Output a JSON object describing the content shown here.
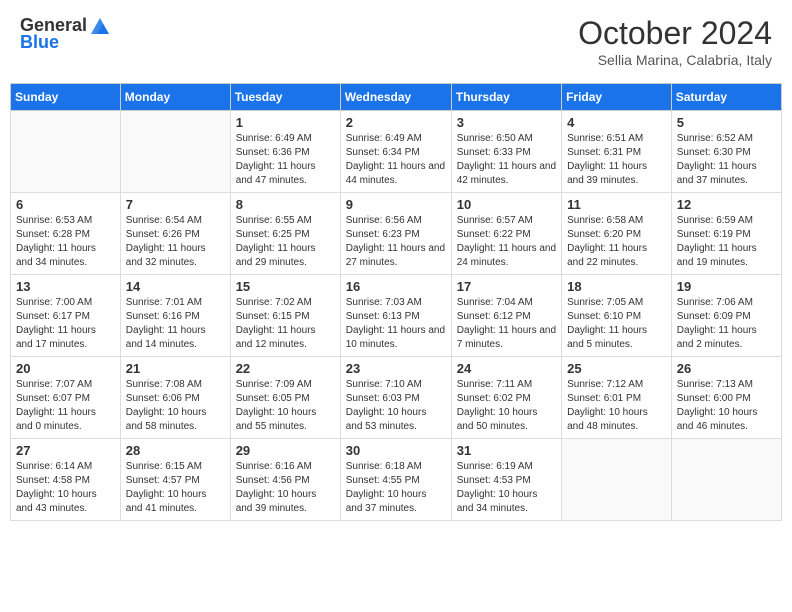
{
  "header": {
    "logo_general": "General",
    "logo_blue": "Blue",
    "month_title": "October 2024",
    "subtitle": "Sellia Marina, Calabria, Italy"
  },
  "weekdays": [
    "Sunday",
    "Monday",
    "Tuesday",
    "Wednesday",
    "Thursday",
    "Friday",
    "Saturday"
  ],
  "weeks": [
    [
      {
        "day": "",
        "info": ""
      },
      {
        "day": "",
        "info": ""
      },
      {
        "day": "1",
        "info": "Sunrise: 6:49 AM\nSunset: 6:36 PM\nDaylight: 11 hours and 47 minutes."
      },
      {
        "day": "2",
        "info": "Sunrise: 6:49 AM\nSunset: 6:34 PM\nDaylight: 11 hours and 44 minutes."
      },
      {
        "day": "3",
        "info": "Sunrise: 6:50 AM\nSunset: 6:33 PM\nDaylight: 11 hours and 42 minutes."
      },
      {
        "day": "4",
        "info": "Sunrise: 6:51 AM\nSunset: 6:31 PM\nDaylight: 11 hours and 39 minutes."
      },
      {
        "day": "5",
        "info": "Sunrise: 6:52 AM\nSunset: 6:30 PM\nDaylight: 11 hours and 37 minutes."
      }
    ],
    [
      {
        "day": "6",
        "info": "Sunrise: 6:53 AM\nSunset: 6:28 PM\nDaylight: 11 hours and 34 minutes."
      },
      {
        "day": "7",
        "info": "Sunrise: 6:54 AM\nSunset: 6:26 PM\nDaylight: 11 hours and 32 minutes."
      },
      {
        "day": "8",
        "info": "Sunrise: 6:55 AM\nSunset: 6:25 PM\nDaylight: 11 hours and 29 minutes."
      },
      {
        "day": "9",
        "info": "Sunrise: 6:56 AM\nSunset: 6:23 PM\nDaylight: 11 hours and 27 minutes."
      },
      {
        "day": "10",
        "info": "Sunrise: 6:57 AM\nSunset: 6:22 PM\nDaylight: 11 hours and 24 minutes."
      },
      {
        "day": "11",
        "info": "Sunrise: 6:58 AM\nSunset: 6:20 PM\nDaylight: 11 hours and 22 minutes."
      },
      {
        "day": "12",
        "info": "Sunrise: 6:59 AM\nSunset: 6:19 PM\nDaylight: 11 hours and 19 minutes."
      }
    ],
    [
      {
        "day": "13",
        "info": "Sunrise: 7:00 AM\nSunset: 6:17 PM\nDaylight: 11 hours and 17 minutes."
      },
      {
        "day": "14",
        "info": "Sunrise: 7:01 AM\nSunset: 6:16 PM\nDaylight: 11 hours and 14 minutes."
      },
      {
        "day": "15",
        "info": "Sunrise: 7:02 AM\nSunset: 6:15 PM\nDaylight: 11 hours and 12 minutes."
      },
      {
        "day": "16",
        "info": "Sunrise: 7:03 AM\nSunset: 6:13 PM\nDaylight: 11 hours and 10 minutes."
      },
      {
        "day": "17",
        "info": "Sunrise: 7:04 AM\nSunset: 6:12 PM\nDaylight: 11 hours and 7 minutes."
      },
      {
        "day": "18",
        "info": "Sunrise: 7:05 AM\nSunset: 6:10 PM\nDaylight: 11 hours and 5 minutes."
      },
      {
        "day": "19",
        "info": "Sunrise: 7:06 AM\nSunset: 6:09 PM\nDaylight: 11 hours and 2 minutes."
      }
    ],
    [
      {
        "day": "20",
        "info": "Sunrise: 7:07 AM\nSunset: 6:07 PM\nDaylight: 11 hours and 0 minutes."
      },
      {
        "day": "21",
        "info": "Sunrise: 7:08 AM\nSunset: 6:06 PM\nDaylight: 10 hours and 58 minutes."
      },
      {
        "day": "22",
        "info": "Sunrise: 7:09 AM\nSunset: 6:05 PM\nDaylight: 10 hours and 55 minutes."
      },
      {
        "day": "23",
        "info": "Sunrise: 7:10 AM\nSunset: 6:03 PM\nDaylight: 10 hours and 53 minutes."
      },
      {
        "day": "24",
        "info": "Sunrise: 7:11 AM\nSunset: 6:02 PM\nDaylight: 10 hours and 50 minutes."
      },
      {
        "day": "25",
        "info": "Sunrise: 7:12 AM\nSunset: 6:01 PM\nDaylight: 10 hours and 48 minutes."
      },
      {
        "day": "26",
        "info": "Sunrise: 7:13 AM\nSunset: 6:00 PM\nDaylight: 10 hours and 46 minutes."
      }
    ],
    [
      {
        "day": "27",
        "info": "Sunrise: 6:14 AM\nSunset: 4:58 PM\nDaylight: 10 hours and 43 minutes."
      },
      {
        "day": "28",
        "info": "Sunrise: 6:15 AM\nSunset: 4:57 PM\nDaylight: 10 hours and 41 minutes."
      },
      {
        "day": "29",
        "info": "Sunrise: 6:16 AM\nSunset: 4:56 PM\nDaylight: 10 hours and 39 minutes."
      },
      {
        "day": "30",
        "info": "Sunrise: 6:18 AM\nSunset: 4:55 PM\nDaylight: 10 hours and 37 minutes."
      },
      {
        "day": "31",
        "info": "Sunrise: 6:19 AM\nSunset: 4:53 PM\nDaylight: 10 hours and 34 minutes."
      },
      {
        "day": "",
        "info": ""
      },
      {
        "day": "",
        "info": ""
      }
    ]
  ]
}
